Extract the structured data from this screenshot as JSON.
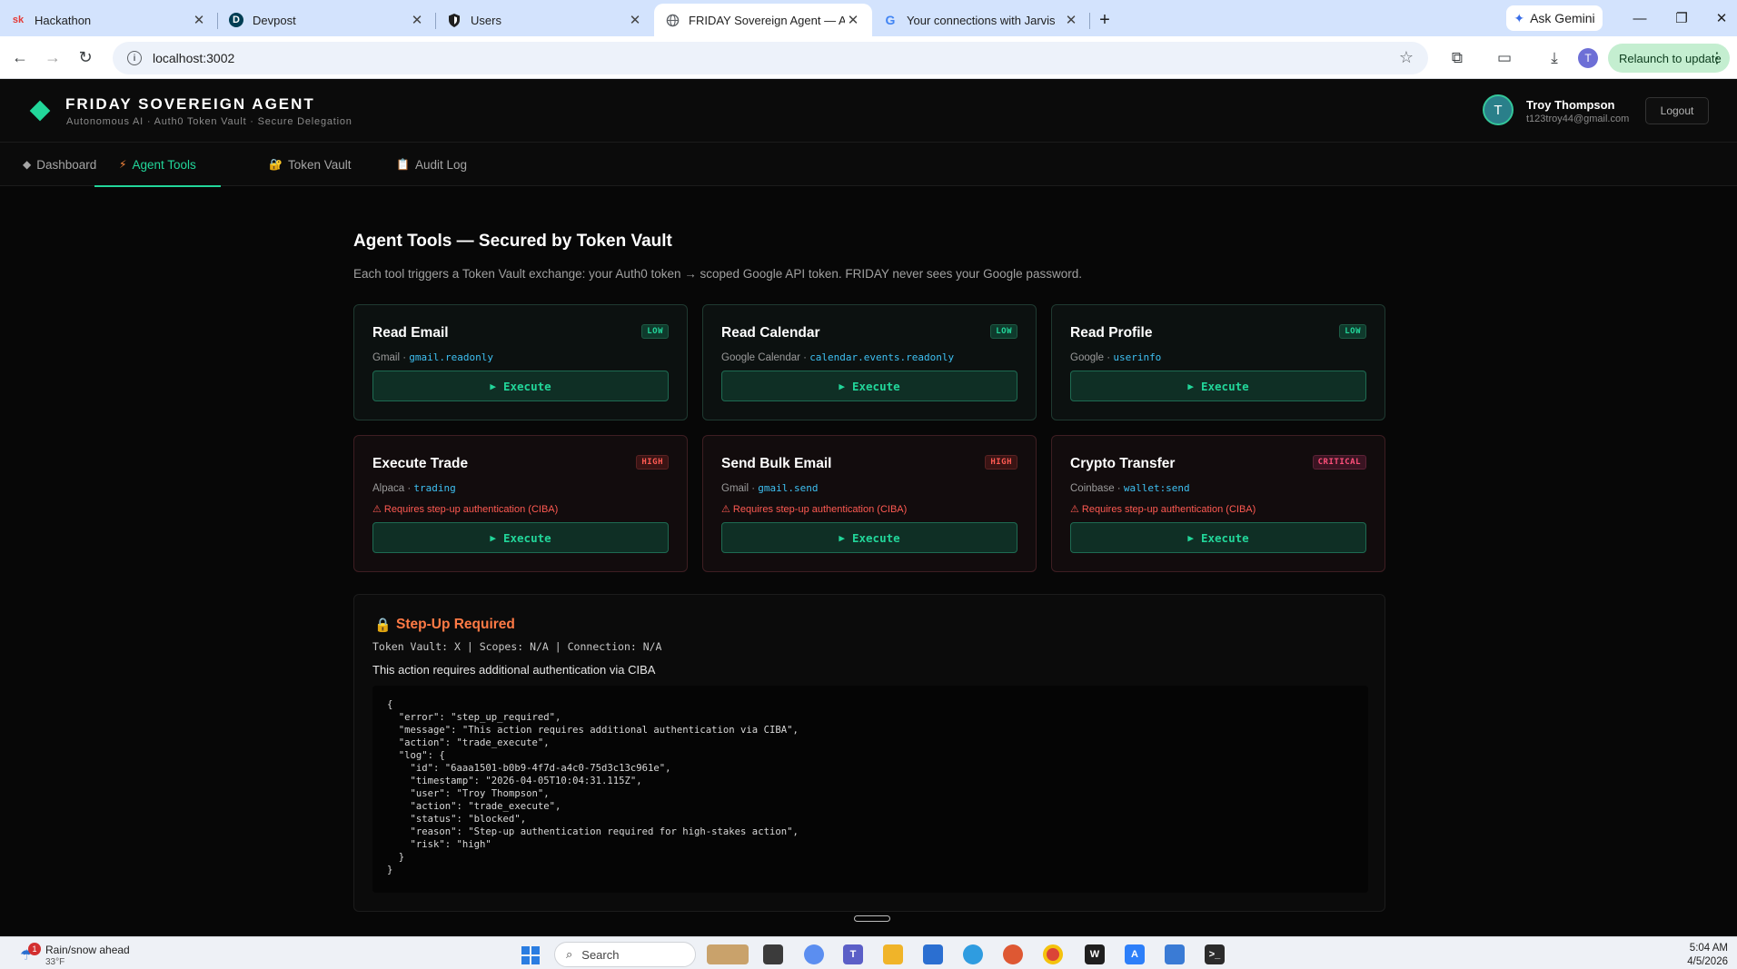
{
  "browser": {
    "tabs": [
      {
        "title": "Hackathon",
        "favicon": "sk",
        "favicon_color": "#e53935"
      },
      {
        "title": "Devpost",
        "favicon": "D",
        "favicon_color": "#003e54"
      },
      {
        "title": "Users",
        "favicon": "shield-icon",
        "favicon_color": "#1f1f1f"
      },
      {
        "title": "FRIDAY Sovereign Agent — Aut",
        "favicon": "globe-icon",
        "favicon_color": "#5f6368",
        "active": true
      },
      {
        "title": "Your connections with Jarvis",
        "favicon": "G",
        "favicon_color": "#4285f4"
      }
    ],
    "gemini_label": "Ask Gemini",
    "url": "localhost:3002",
    "profile_initial": "T",
    "relaunch_label": "Relaunch to update"
  },
  "header": {
    "brand": "FRIDAY SOVEREIGN AGENT",
    "subtitle": "Autonomous AI · Auth0 Token Vault · Secure Delegation",
    "user_initial": "T",
    "user_name": "Troy Thompson",
    "user_email": "t123troy44@gmail.com",
    "logout_label": "Logout"
  },
  "nav": [
    {
      "label": "Dashboard",
      "icon": "◆"
    },
    {
      "label": "Agent Tools",
      "icon": "⚡",
      "active": true
    },
    {
      "label": "Token Vault",
      "icon": "🔐"
    },
    {
      "label": "Audit Log",
      "icon": "📋"
    }
  ],
  "main": {
    "title": "Agent Tools — Secured by Token Vault",
    "description": "Each tool triggers a Token Vault exchange: your Auth0 token → scoped Google API token. FRIDAY never sees your Google password.",
    "execute_label": "Execute",
    "tools": [
      {
        "name": "Read Email",
        "risk": "LOW",
        "service": "Gmail",
        "scope": "gmail.readonly"
      },
      {
        "name": "Read Calendar",
        "risk": "LOW",
        "service": "Google Calendar",
        "scope": "calendar.events.readonly"
      },
      {
        "name": "Read Profile",
        "risk": "LOW",
        "service": "Google",
        "scope": "userinfo"
      },
      {
        "name": "Execute Trade",
        "risk": "HIGH",
        "service": "Alpaca",
        "scope": "trading",
        "warning": "⚠ Requires step-up authentication (CIBA)"
      },
      {
        "name": "Send Bulk Email",
        "risk": "HIGH",
        "service": "Gmail",
        "scope": "gmail.send",
        "warning": "⚠ Requires step-up authentication (CIBA)"
      },
      {
        "name": "Crypto Transfer",
        "risk": "CRITICAL",
        "service": "Coinbase",
        "scope": "wallet:send",
        "warning": "⚠ Requires step-up authentication (CIBA)"
      }
    ]
  },
  "stepup": {
    "title": "Step-Up Required",
    "meta": "Token Vault: X | Scopes: N/A | Connection: N/A",
    "message": "This action requires additional authentication via CIBA",
    "json": "{\n  \"error\": \"step_up_required\",\n  \"message\": \"This action requires additional authentication via CIBA\",\n  \"action\": \"trade_execute\",\n  \"log\": {\n    \"id\": \"6aaa1501-b0b9-4f7d-a4c0-75d3c13c961e\",\n    \"timestamp\": \"2026-04-05T10:04:31.115Z\",\n    \"user\": \"Troy Thompson\",\n    \"action\": \"trade_execute\",\n    \"status\": \"blocked\",\n    \"reason\": \"Step-up authentication required for high-stakes action\",\n    \"risk\": \"high\"\n  }\n}"
  },
  "taskbar": {
    "weather_title": "Rain/snow ahead",
    "weather_temp": "33°F",
    "weather_badge": "1",
    "search_label": "Search",
    "time": "5:04 AM",
    "date": "4/5/2026"
  }
}
